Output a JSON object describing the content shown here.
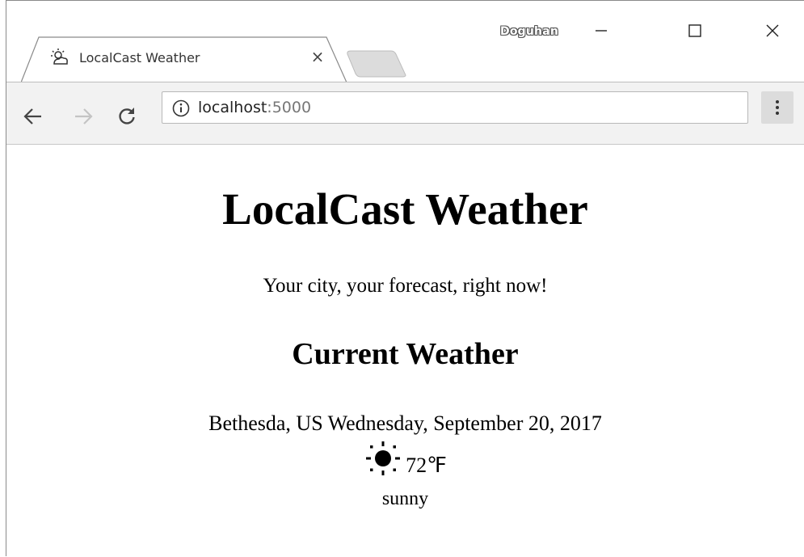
{
  "window": {
    "profile_name": "Doguhan",
    "controls": [
      "minimize",
      "maximize",
      "close"
    ]
  },
  "tab": {
    "title": "LocalCast Weather",
    "icon": "weather-partly-sunny-icon",
    "close_glyph": "×"
  },
  "toolbar": {
    "url_host": "localhost",
    "url_port": ":5000",
    "info_icon": "info-icon"
  },
  "page": {
    "title": "LocalCast Weather",
    "subtitle": "Your city, your forecast, right now!",
    "section_title": "Current Weather",
    "location_date": "Bethesda, US Wednesday, September 20, 2017",
    "temperature": "72℉",
    "condition": "sunny",
    "weather_icon": "sun-icon"
  },
  "colors": {
    "toolbar_bg": "#f2f2f2",
    "tab_bg": "#f2f2f2",
    "newtab_bg": "#dcdcdc"
  }
}
